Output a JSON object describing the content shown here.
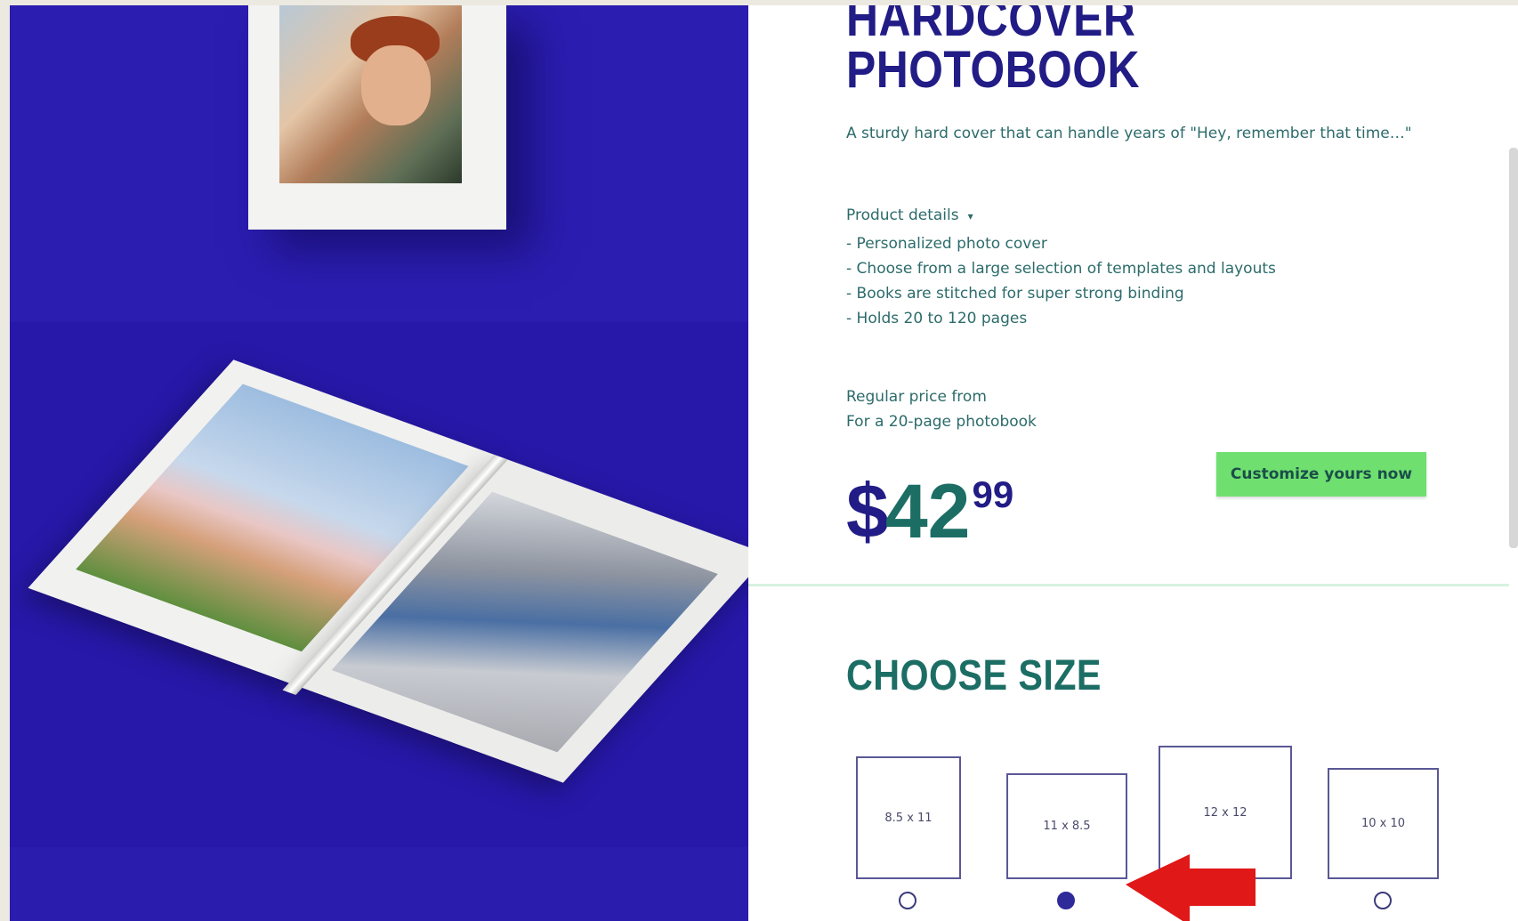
{
  "product": {
    "title_line1": "HARDCOVER",
    "title_line2": "PHOTOBOOK",
    "description": "A sturdy hard cover that can handle years of \"Hey, remember that time…\"",
    "details_label": "Product details",
    "details_caret": "▾",
    "details": [
      "Personalized photo cover",
      "Choose from a large selection of templates and layouts",
      "Books are stitched for super strong binding",
      "Holds 20 to 120 pages"
    ],
    "price_note_line1": "Regular price from",
    "price_note_line2": "For a 20-page photobook",
    "price_currency": "$",
    "price_dollars": "42",
    "price_cents": "99",
    "cta_label": "Customize yours now"
  },
  "size_section": {
    "title": "CHOOSE SIZE",
    "options": [
      {
        "label": "8.5 x 11",
        "selected": false
      },
      {
        "label": "11 x 8.5",
        "selected": true
      },
      {
        "label": "12 x 12",
        "selected": false
      },
      {
        "label": "10 x 10",
        "selected": false
      }
    ]
  },
  "colors": {
    "gallery_bg": "#2a1cab",
    "title": "#221c86",
    "body_text": "#2d6b6b",
    "cta_bg": "#6fe06f",
    "annotation_arrow": "#e01818"
  }
}
